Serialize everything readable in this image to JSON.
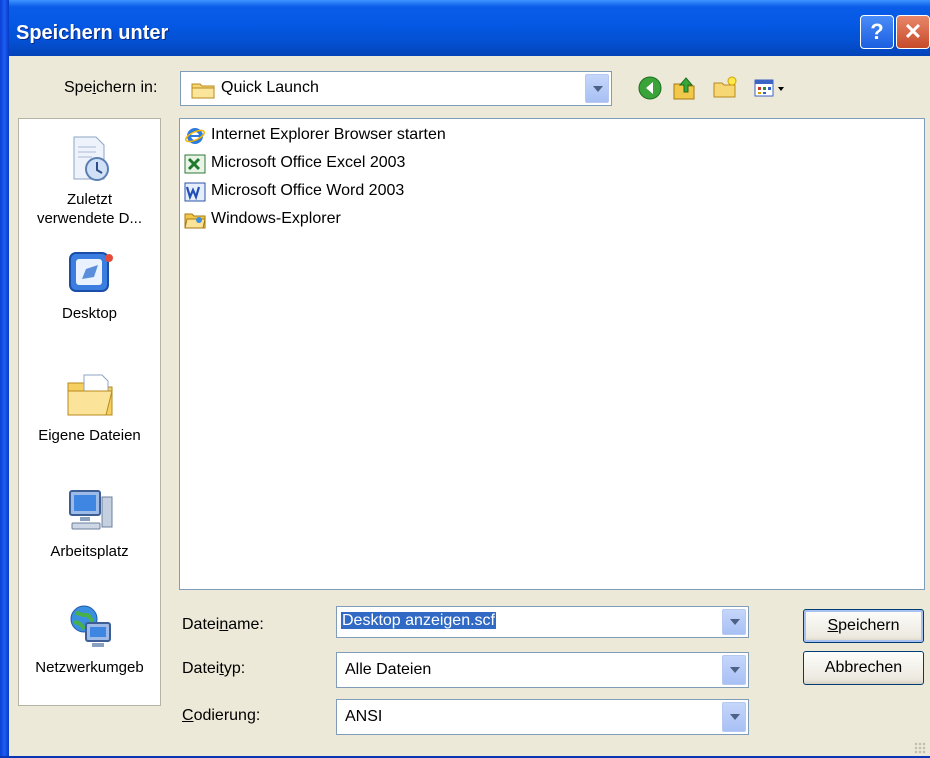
{
  "window": {
    "title": "Speichern unter",
    "help_glyph": "?",
    "close_glyph": "✕"
  },
  "save_in": {
    "label_pre": "Spe",
    "label_accel": "i",
    "label_post": "chern in:",
    "value": "Quick Launch",
    "icon": "folder-icon"
  },
  "toolbar": {
    "icons": [
      "back-icon",
      "up-folder-icon",
      "new-folder-icon",
      "view-menu-icon"
    ]
  },
  "places": [
    {
      "label": "Zuletzt verwendete D...",
      "icon": "recent-documents-icon"
    },
    {
      "label": "Desktop",
      "icon": "desktop-icon"
    },
    {
      "label": "Eigene Dateien",
      "icon": "my-documents-icon"
    },
    {
      "label": "Arbeitsplatz",
      "icon": "my-computer-icon"
    },
    {
      "label": "Netzwerkumgeb",
      "icon": "network-places-icon"
    }
  ],
  "files": [
    {
      "name": "Internet Explorer Browser starten",
      "icon": "internet-explorer-icon"
    },
    {
      "name": "Microsoft Office Excel 2003",
      "icon": "excel-icon"
    },
    {
      "name": "Microsoft Office Word 2003",
      "icon": "word-icon"
    },
    {
      "name": "Windows-Explorer",
      "icon": "explorer-folder-icon"
    }
  ],
  "filename": {
    "label_pre": "Datei",
    "label_accel": "n",
    "label_post": "ame:",
    "value": "Desktop anzeigen.scf"
  },
  "filetype": {
    "label_pre": "Datei",
    "label_accel": "t",
    "label_post": "yp:",
    "value": "Alle Dateien"
  },
  "encoding": {
    "label_pre": "",
    "label_accel": "C",
    "label_post": "odierung:",
    "value": "ANSI"
  },
  "buttons": {
    "save_accel": "S",
    "save_rest": "peichern",
    "cancel": "Abbrechen"
  },
  "colors": {
    "titlebar": "#0458e3",
    "dialog_bg": "#ece9d8",
    "selection": "#316ac5"
  }
}
